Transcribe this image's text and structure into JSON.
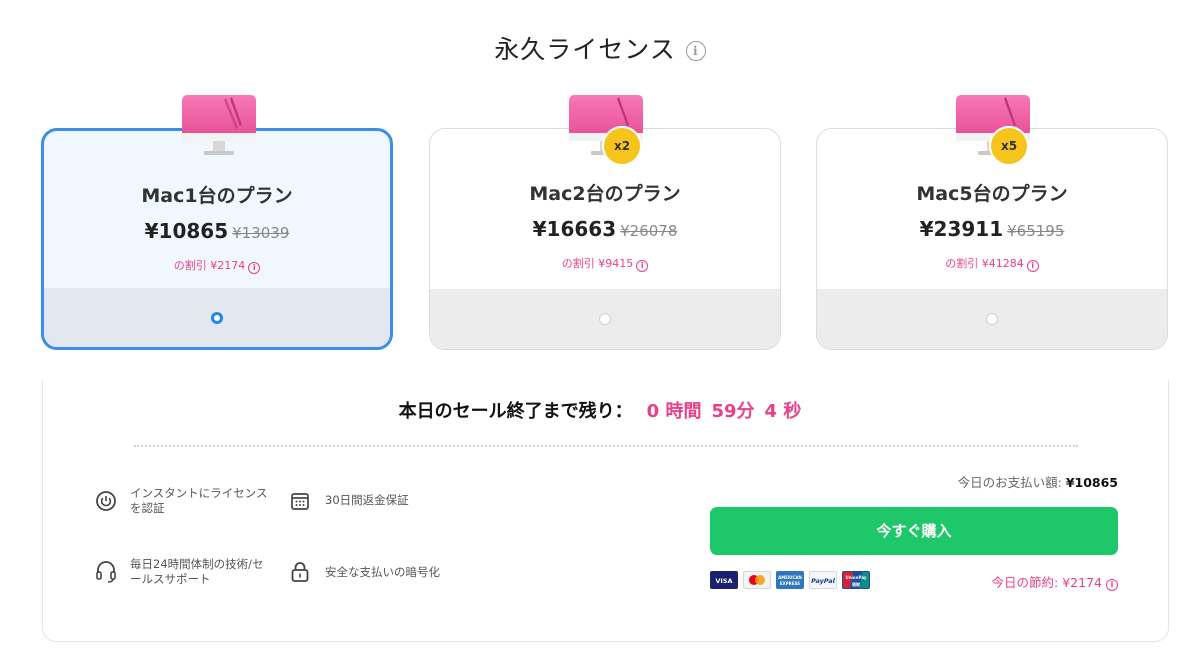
{
  "header": {
    "title": "永久ライセンス",
    "info_icon": "info-icon"
  },
  "plans": [
    {
      "name": "Mac1台のプラン",
      "price": "¥10865",
      "old_price": "¥13039",
      "discount": "の割引 ¥2174",
      "badge": "",
      "selected": true
    },
    {
      "name": "Mac2台のプラン",
      "price": "¥16663",
      "old_price": "¥26078",
      "discount": "の割引 ¥9415",
      "badge": "x2",
      "selected": false
    },
    {
      "name": "Mac5台のプラン",
      "price": "¥23911",
      "old_price": "¥65195",
      "discount": "の割引 ¥41284",
      "badge": "x5",
      "selected": false
    }
  ],
  "countdown": {
    "label": "本日のセール終了まで残り：",
    "hours": "0 時間",
    "minutes": "59分",
    "seconds": "4 秒"
  },
  "features": [
    {
      "icon": "power-icon",
      "text1": "インスタントにライセンス",
      "text2": "を認証"
    },
    {
      "icon": "calendar-icon",
      "text1": "30日間返金保証",
      "text2": ""
    },
    {
      "icon": "headset-icon",
      "text1": "毎日24時間体制の技術/セ",
      "text2": "ールスサポート"
    },
    {
      "icon": "lock-icon",
      "text1": "安全な支払いの暗号化",
      "text2": ""
    }
  ],
  "payment": {
    "total_label": "今日のお支払い額: ",
    "total_value": "¥10865",
    "buy_label": "今すぐ購入",
    "savings": "今日の節約: ¥2174",
    "methods": [
      "VISA",
      "Mastercard",
      "AMERICAN EXPRESS",
      "PayPal",
      "UnionPay 银联"
    ]
  },
  "colors": {
    "accent": "#ec3f89",
    "buy": "#1ec76a",
    "selected_border": "#3d8ee8",
    "badge": "#f6c51b"
  }
}
